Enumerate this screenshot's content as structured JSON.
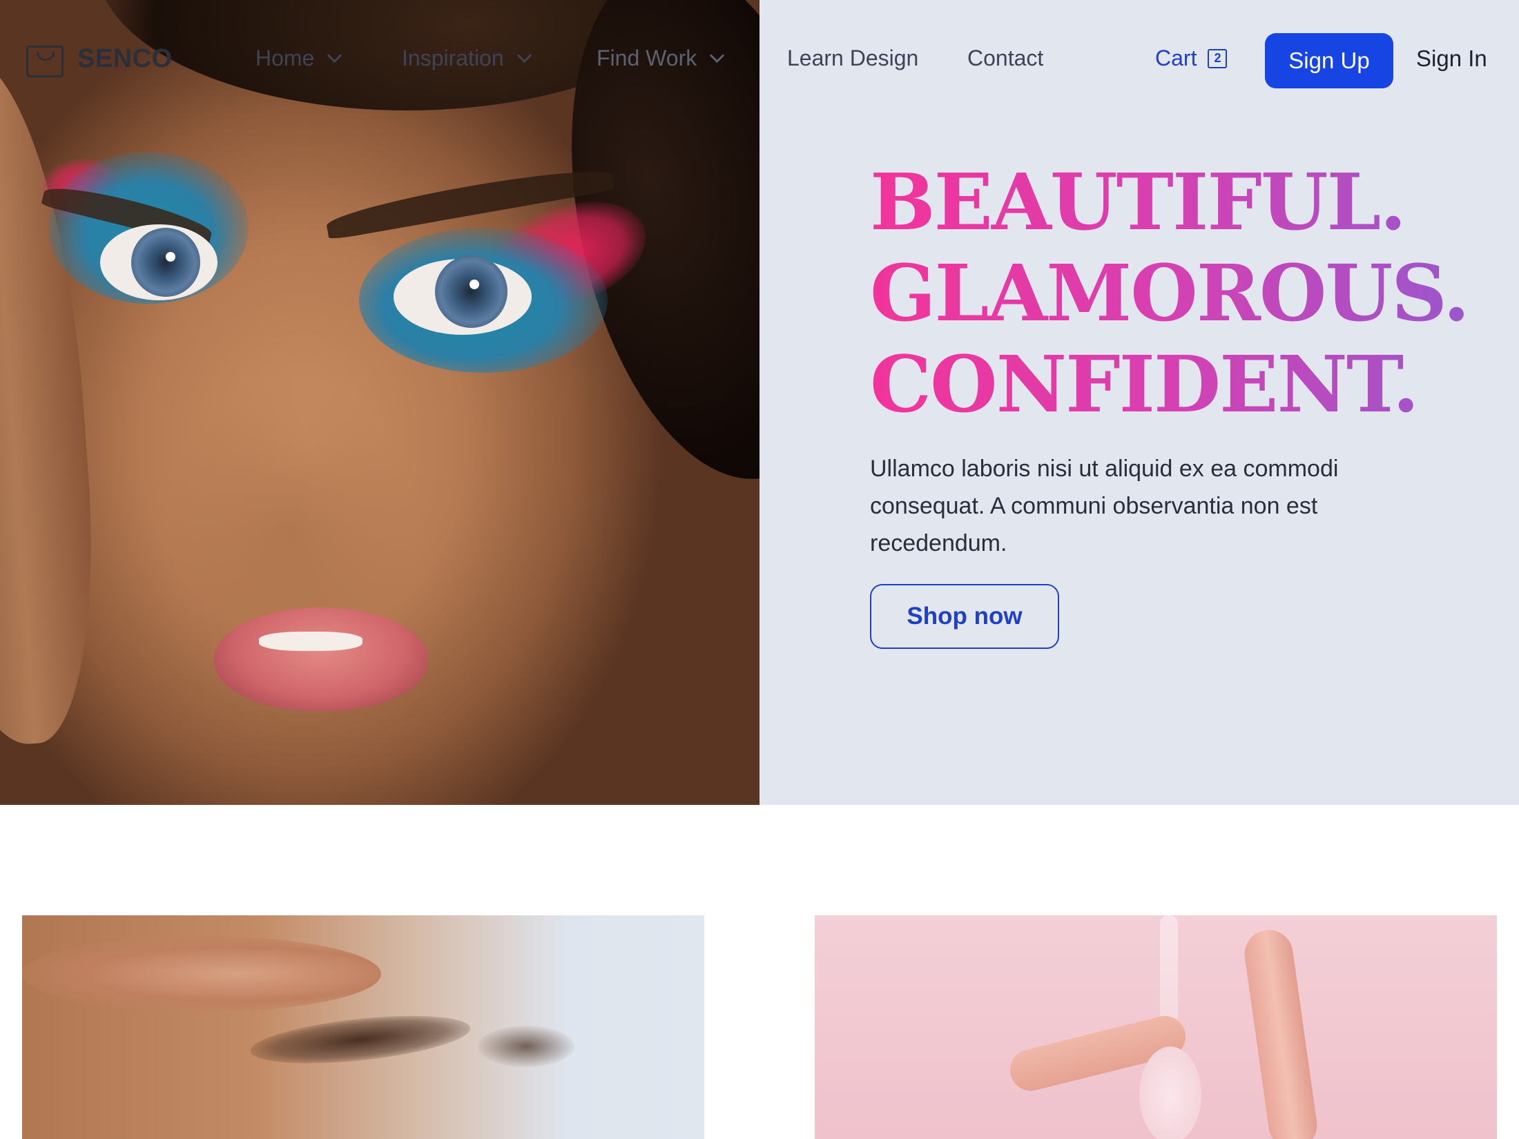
{
  "brand": {
    "name": "SENCO"
  },
  "nav": {
    "items": [
      {
        "label": "Home",
        "has_dropdown": true
      },
      {
        "label": "Inspiration",
        "has_dropdown": true
      },
      {
        "label": "Find Work",
        "has_dropdown": true
      },
      {
        "label": "Learn Design",
        "has_dropdown": false
      },
      {
        "label": "Contact",
        "has_dropdown": false
      }
    ],
    "cart": {
      "label": "Cart",
      "count": "2"
    },
    "signup_label": "Sign Up",
    "signin_label": "Sign In"
  },
  "hero": {
    "headline": [
      "BEAUTIFUL.",
      "GLAMOROUS.",
      "CONFIDENT."
    ],
    "body": "Ullamco laboris nisi ut aliquid ex ea commodi consequat. A communi observantia non est recedendum.",
    "cta_label": "Shop now"
  },
  "colors": {
    "accent": "#1745e3",
    "link": "#1f3fc4",
    "hero_bg": "#e2e6ef",
    "headline_gradient": [
      "#f2349a",
      "#9658cf"
    ],
    "text": "#2a2e3a"
  },
  "icons": {
    "logo": "shopping-bag-icon",
    "dropdown": "chevron-down-icon",
    "cart_badge": "cart-count-badge"
  }
}
